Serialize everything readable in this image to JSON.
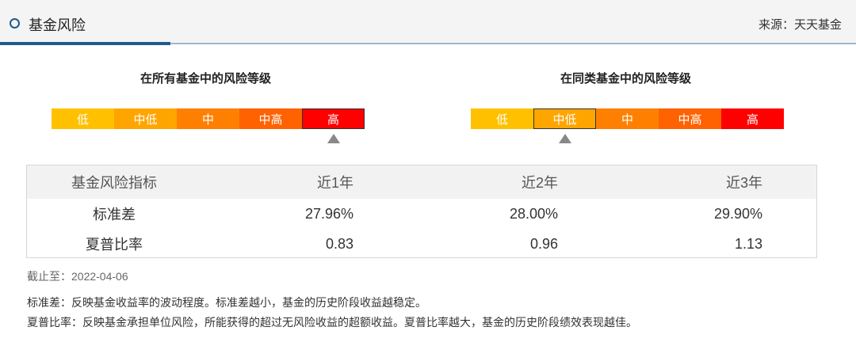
{
  "header": {
    "title": "基金风险",
    "source": "来源：天天基金"
  },
  "left_panel": {
    "title": "在所有基金中的风险等级",
    "levels": [
      {
        "label": "低",
        "color": "#ffc000"
      },
      {
        "label": "中低",
        "color": "#ffa500"
      },
      {
        "label": "中",
        "color": "#ff8000"
      },
      {
        "label": "中高",
        "color": "#ff6200"
      },
      {
        "label": "高",
        "color": "#ff0000"
      }
    ],
    "selected": "高"
  },
  "right_panel": {
    "title": "在同类基金中的风险等级",
    "levels": [
      {
        "label": "低",
        "color": "#ffc000"
      },
      {
        "label": "中低",
        "color": "#ffa500"
      },
      {
        "label": "中",
        "color": "#ff8000"
      },
      {
        "label": "中高",
        "color": "#ff6200"
      },
      {
        "label": "高",
        "color": "#ff0000"
      }
    ],
    "selected": "中低"
  },
  "table": {
    "headers": [
      "基金风险指标",
      "近1年",
      "近2年",
      "近3年"
    ],
    "rows": [
      [
        "标准差",
        "27.96%",
        "28.00%",
        "29.90%"
      ],
      [
        "夏普比率",
        "0.83",
        "0.96",
        "1.13"
      ]
    ]
  },
  "as_of": "截止至：2022-04-06",
  "notes": [
    "标准差：反映基金收益率的波动程度。标准差越小，基金的历史阶段收益越稳定。",
    "夏普比率：反映基金承担单位风险，所能获得的超过无风险收益的超额收益。夏普比率越大，基金的历史阶段绩效表现越佳。"
  ],
  "colors": {
    "accent": "#1f5a8c",
    "header_bg": "#f4f4f4",
    "table_head_bg": "#f2f2f2"
  }
}
